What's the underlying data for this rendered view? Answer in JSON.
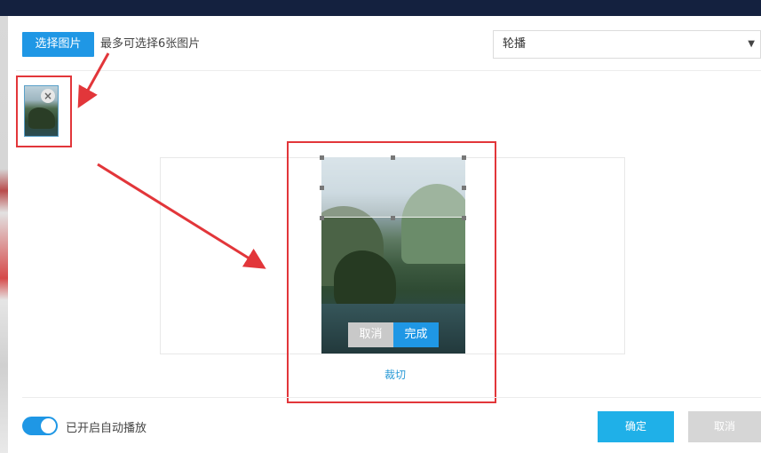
{
  "header": {
    "select_button_label": "选择图片",
    "hint": "最多可选择6张图片",
    "mode_select_value": "轮播"
  },
  "thumbnail": {
    "remove_symbol": "×"
  },
  "crop": {
    "cancel_label": "取消",
    "done_label": "完成",
    "crop_link_label": "裁切"
  },
  "footer": {
    "autoplay_label": "已开启自动播放",
    "autoplay_on": true,
    "confirm_label": "确定",
    "cancel_label": "取消"
  },
  "colors": {
    "accent": "#1f97e5",
    "confirm": "#1fb0e8",
    "annotation_red": "#e2363a",
    "top_bar": "#14213f"
  },
  "icons": {
    "dropdown": "caret-down-icon",
    "remove": "close-icon"
  }
}
